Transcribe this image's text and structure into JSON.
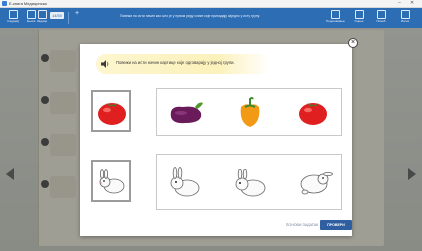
{
  "window": {
    "title": "Е-книга Медицинска"
  },
  "toolbar": {
    "items": [
      {
        "label": "Садржај"
      },
      {
        "label": "Књига"
      },
      {
        "label": "Задаци"
      }
    ],
    "page_badge": "14/50",
    "center_text": "Повежи на исти начин као што је у првом реду слике које припадају заједно у исту групу.",
    "right_items": [
      {
        "label": "Подешавања"
      },
      {
        "label": "Оцене"
      },
      {
        "label": "Помоћ"
      },
      {
        "label": "Излаз"
      }
    ]
  },
  "modal": {
    "instruction": "Повежи на исти начин картице које одговарају у једној групи.",
    "rows": [
      {
        "left": "tomato",
        "options": [
          "eggplant",
          "pepper",
          "tomato"
        ]
      },
      {
        "left": "rabbit",
        "options": [
          "rabbit",
          "rabbit",
          "rabbit"
        ]
      }
    ],
    "reset_label": "ПОНОВИ ЗАДАТАК",
    "check_label": "ПРОВЕРИ"
  },
  "colors": {
    "accent": "#2f5fa0",
    "toolbar": "#2d6db3",
    "instruction_bg": "#fbf1bb"
  }
}
